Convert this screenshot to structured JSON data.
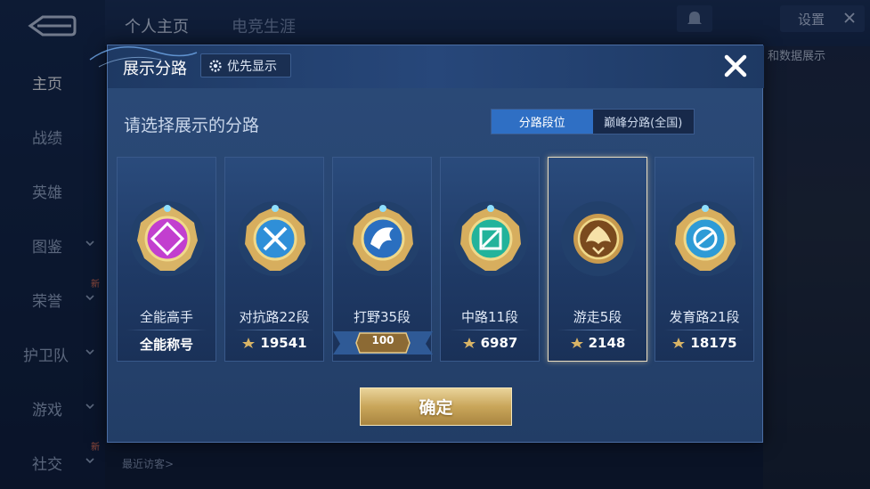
{
  "sidebar": {
    "items": [
      {
        "label": "主页",
        "active": true
      },
      {
        "label": "战绩"
      },
      {
        "label": "英雄"
      },
      {
        "label": "图鉴"
      },
      {
        "label": "荣誉",
        "badge": "新"
      },
      {
        "label": "护卫队"
      },
      {
        "label": "游戏"
      },
      {
        "label": "社交",
        "badge": "新"
      }
    ]
  },
  "header": {
    "tabs": [
      "个人主页",
      "电竞生涯"
    ],
    "settings_label": "设置"
  },
  "background": {
    "right_label": "和数据展示",
    "recent_visitors": "最近访客>"
  },
  "modal": {
    "title": "展示分路",
    "priority_label": "优先显示",
    "subtitle": "请选择展示的分路",
    "toggle": [
      {
        "label": "分路段位",
        "active": true
      },
      {
        "label": "巅峰分路(全国)",
        "active": false
      }
    ],
    "cards": [
      {
        "name": "全能高手",
        "value": "全能称号",
        "badge_color": "#c23fcf",
        "badge_icon": "all-round-icon",
        "selected": false
      },
      {
        "name": "对抗路22段",
        "value": "19541",
        "badge_color": "#2f8fd8",
        "badge_icon": "crossed-swords-icon",
        "selected": false
      },
      {
        "name": "打野35段",
        "value": "100",
        "badge_color": "#2a6fc0",
        "badge_icon": "dragon-icon",
        "selected": false
      },
      {
        "name": "中路11段",
        "value": "6987",
        "badge_color": "#23b39b",
        "badge_icon": "staff-icon",
        "selected": false
      },
      {
        "name": "游走5段",
        "value": "2148",
        "badge_color": "#7a4a1e",
        "badge_icon": "wings-icon",
        "selected": true
      },
      {
        "name": "发育路21段",
        "value": "18175",
        "badge_color": "#2e9bd6",
        "badge_icon": "bow-icon",
        "selected": false
      }
    ],
    "confirm_label": "确定"
  }
}
